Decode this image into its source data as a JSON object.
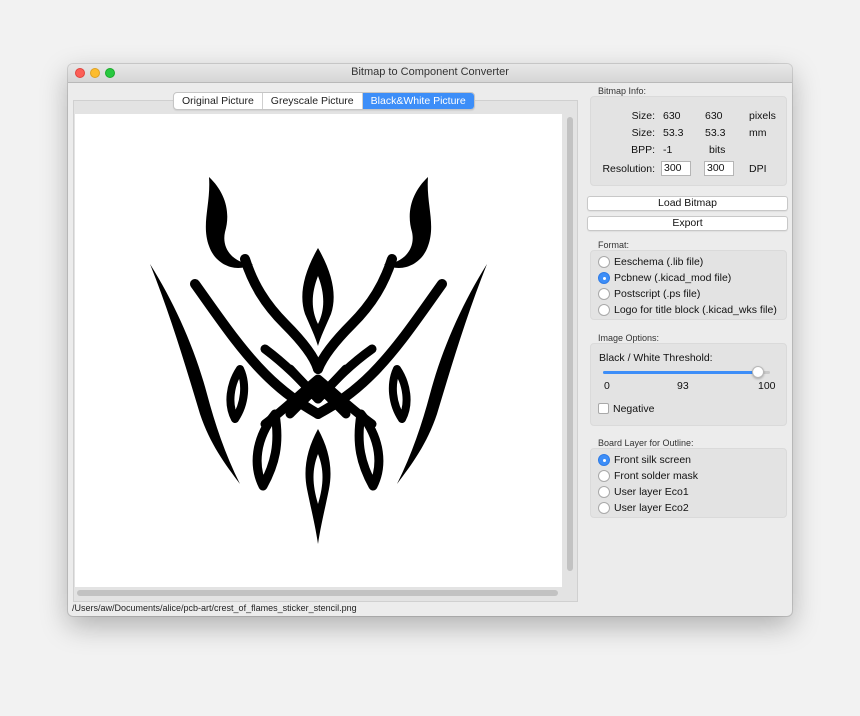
{
  "window": {
    "title": "Bitmap to Component Converter"
  },
  "tabs": [
    {
      "label": "Original Picture",
      "active": false
    },
    {
      "label": "Greyscale Picture",
      "active": false
    },
    {
      "label": "Black&White Picture",
      "active": true
    }
  ],
  "status_path": "/Users/aw/Documents/alice/pcb-art/crest_of_flames_sticker_stencil.png",
  "bitmap_info": {
    "heading": "Bitmap Info:",
    "size_label": "Size:",
    "size_px": [
      "630",
      "630"
    ],
    "size_px_unit": "pixels",
    "size_mm": [
      "53.3",
      "53.3"
    ],
    "size_mm_unit": "mm",
    "bpp_label": "BPP:",
    "bpp_value": "-1",
    "bpp_unit": "bits",
    "resolution_label": "Resolution:",
    "resolution_x": "300",
    "resolution_y": "300",
    "resolution_unit": "DPI"
  },
  "buttons": {
    "load": "Load Bitmap",
    "export": "Export"
  },
  "format": {
    "heading": "Format:",
    "options": [
      {
        "label": "Eeschema (.lib file)",
        "selected": false
      },
      {
        "label": "Pcbnew (.kicad_mod file)",
        "selected": true
      },
      {
        "label": "Postscript (.ps file)",
        "selected": false
      },
      {
        "label": "Logo for title block (.kicad_wks file)",
        "selected": false
      }
    ]
  },
  "image_options": {
    "heading": "Image Options:",
    "threshold_label": "Black / White Threshold:",
    "threshold_min": "0",
    "threshold_value": "93",
    "threshold_max": "100",
    "threshold_fraction": 0.93,
    "negative_label": "Negative",
    "negative_checked": false
  },
  "board_layer": {
    "heading": "Board Layer for Outline:",
    "options": [
      {
        "label": "Front silk screen",
        "selected": true
      },
      {
        "label": "Front solder mask",
        "selected": false
      },
      {
        "label": "User layer Eco1",
        "selected": false
      },
      {
        "label": "User layer Eco2",
        "selected": false
      }
    ]
  },
  "colors": {
    "accent": "#3d8ef8",
    "image_ink": "#000000"
  },
  "icons": [
    "close-window-icon",
    "minimize-window-icon",
    "maximize-window-icon",
    "radio-selected-icon",
    "radio-unselected-icon"
  ]
}
